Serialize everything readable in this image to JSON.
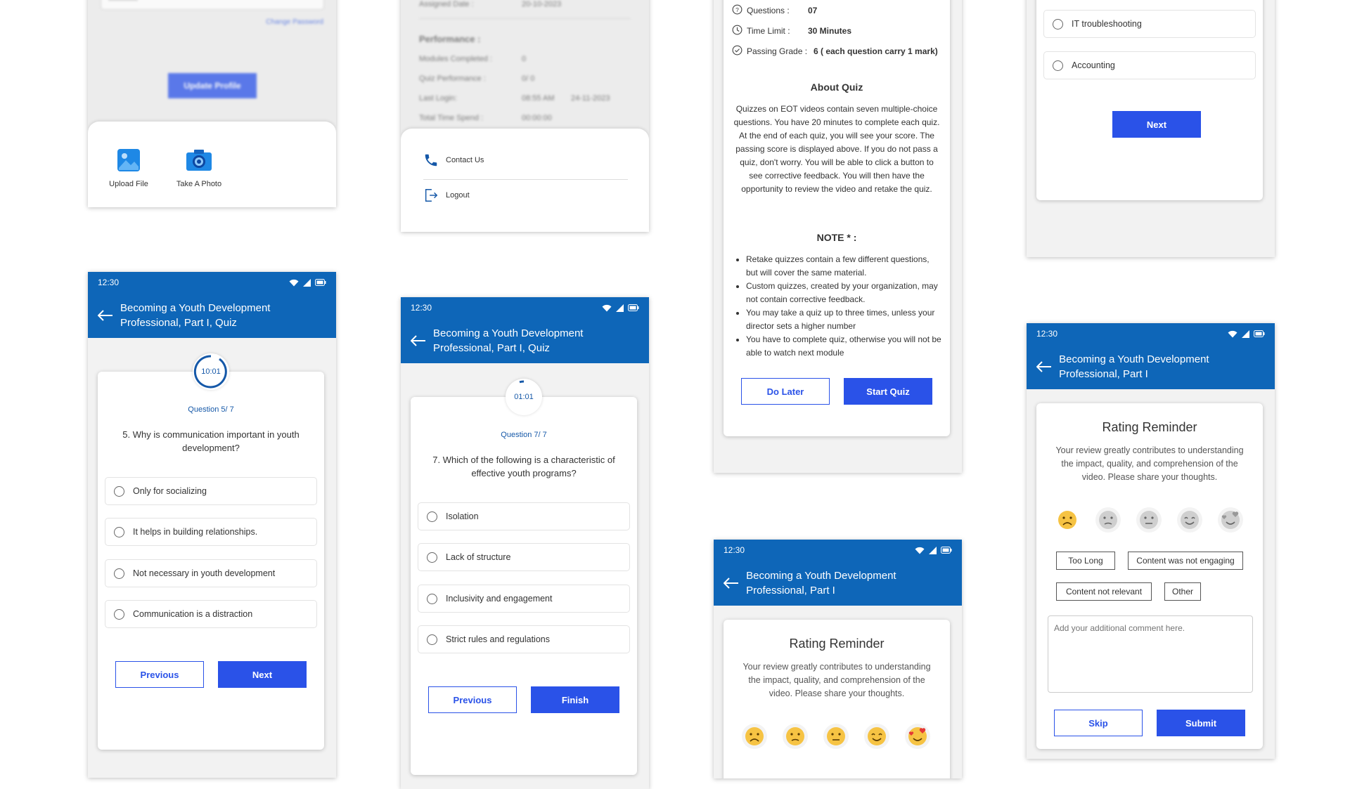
{
  "status": {
    "time": "12:30"
  },
  "profile_screen": {
    "password_mask": "••••••••••••",
    "change_password": "Change Password",
    "update_button": "Update Profile",
    "upload_file": "Upload File",
    "take_photo": "Take A Photo"
  },
  "menu_screen": {
    "assigned_label": "Assigned Date :",
    "assigned_value": "20-10-2023",
    "performance_heading": "Performance :",
    "modules_label": "Modules Completed :",
    "modules_value": "0",
    "quiz_perf_label": "Quiz Performance :",
    "quiz_perf_value": "0/ 0",
    "last_login_label": "Last Login:",
    "last_login_time": "08:55 AM",
    "last_login_date": "24-11-2023",
    "time_spent_label": "Total Time Spend :",
    "time_spent_value": "00:00:00",
    "contact_us": "Contact Us",
    "logout": "Logout"
  },
  "quiz_q5": {
    "title": "Becoming a Youth Development Professional, Part I, Quiz",
    "timer": "10:01",
    "question_number": "Question 5/ 7",
    "question": "5. Why is communication important in youth development?",
    "options": [
      "Only for socializing",
      "It helps in building relationships.",
      "Not necessary in youth development",
      "Communication is a distraction"
    ],
    "previous": "Previous",
    "next": "Next"
  },
  "quiz_q7": {
    "title": "Becoming a Youth Development Professional, Part I, Quiz",
    "timer": "01:01",
    "question_number": "Question 7/ 7",
    "question": "7. Which of the following is a characteristic of effective youth programs?",
    "options": [
      "Isolation",
      "Lack of structure",
      "Inclusivity and engagement",
      "Strict rules and regulations"
    ],
    "previous": "Previous",
    "finish": "Finish"
  },
  "quiz_intro": {
    "questions_label": "Questions :",
    "questions_value": "07",
    "time_label": "Time Limit :",
    "time_value": "30 Minutes",
    "passing_label": "Passing Grade :",
    "passing_value": "6 ( each question carry 1 mark)",
    "about_heading": "About Quiz",
    "about_text": "Quizzes on EOT videos contain seven multiple-choice questions. You have 20 minutes to complete each quiz. At the end of each quiz, you will see your score. The passing score is displayed above. If you do not pass a quiz, don't worry. You will be able to click a button to see corrective feedback. You will then have the opportunity to review the video and retake the quiz.",
    "note_heading": "NOTE * :",
    "notes": [
      "Retake quizzes contain a few different questions, but will cover the same material.",
      "Custom quizzes, created by your organization, may not contain corrective feedback.",
      "You may take a quiz up to three times, unless your director sets a higher number",
      "You have to complete quiz, otherwise you will not be able to watch next module"
    ],
    "do_later": "Do Later",
    "start_quiz": "Start Quiz"
  },
  "rating_mid": {
    "title": "Becoming a Youth Development Professional, Part I",
    "heading": "Rating Reminder",
    "text": "Your review greatly contributes to understanding the impact, quality, and comprehension of the video. Please share your thoughts."
  },
  "quiz_tail": {
    "options": [
      "IT troubleshooting",
      "Accounting"
    ],
    "next": "Next"
  },
  "rating_right": {
    "title": "Becoming a Youth Development Professional, Part I",
    "heading": "Rating Reminder",
    "text": "Your review greatly contributes to understanding the impact, quality, and comprehension of the video. Please share your thoughts.",
    "chips": [
      "Too Long",
      "Content was not engaging",
      "Content not relevant",
      "Other"
    ],
    "comment_placeholder": "Add your additional comment here.",
    "skip": "Skip",
    "submit": "Submit"
  },
  "colors": {
    "primary": "#0e66b8",
    "accent": "#2a52e8"
  }
}
